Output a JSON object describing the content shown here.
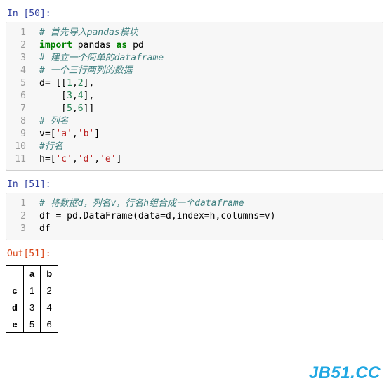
{
  "cells": [
    {
      "prompt": "In [50]:",
      "lines": [
        {
          "n": "1",
          "tokens": [
            {
              "t": "# 首先导入pandas模块",
              "c": "tok-comment"
            }
          ]
        },
        {
          "n": "2",
          "tokens": [
            {
              "t": "import",
              "c": "tok-keyword"
            },
            {
              "t": " pandas "
            },
            {
              "t": "as",
              "c": "tok-keyword"
            },
            {
              "t": " pd"
            }
          ]
        },
        {
          "n": "3",
          "tokens": [
            {
              "t": "# 建立一个简单的dataframe",
              "c": "tok-comment"
            }
          ]
        },
        {
          "n": "4",
          "tokens": [
            {
              "t": "# 一个三行两列的数据",
              "c": "tok-comment"
            }
          ]
        },
        {
          "n": "5",
          "tokens": [
            {
              "t": "d= [["
            },
            {
              "t": "1",
              "c": "tok-number"
            },
            {
              "t": ","
            },
            {
              "t": "2",
              "c": "tok-number"
            },
            {
              "t": "],"
            }
          ]
        },
        {
          "n": "6",
          "tokens": [
            {
              "t": "    ["
            },
            {
              "t": "3",
              "c": "tok-number"
            },
            {
              "t": ","
            },
            {
              "t": "4",
              "c": "tok-number"
            },
            {
              "t": "],"
            }
          ]
        },
        {
          "n": "7",
          "tokens": [
            {
              "t": "    ["
            },
            {
              "t": "5",
              "c": "tok-number"
            },
            {
              "t": ","
            },
            {
              "t": "6",
              "c": "tok-number"
            },
            {
              "t": "]]"
            }
          ]
        },
        {
          "n": "8",
          "tokens": [
            {
              "t": "# 列名",
              "c": "tok-comment"
            }
          ]
        },
        {
          "n": "9",
          "tokens": [
            {
              "t": "v=["
            },
            {
              "t": "'a'",
              "c": "tok-string"
            },
            {
              "t": ","
            },
            {
              "t": "'b'",
              "c": "tok-string"
            },
            {
              "t": "]"
            }
          ]
        },
        {
          "n": "10",
          "tokens": [
            {
              "t": "#行名",
              "c": "tok-comment"
            }
          ]
        },
        {
          "n": "11",
          "tokens": [
            {
              "t": "h=["
            },
            {
              "t": "'c'",
              "c": "tok-string"
            },
            {
              "t": ","
            },
            {
              "t": "'d'",
              "c": "tok-string"
            },
            {
              "t": ","
            },
            {
              "t": "'e'",
              "c": "tok-string"
            },
            {
              "t": "]"
            }
          ]
        }
      ]
    },
    {
      "prompt": "In [51]:",
      "lines": [
        {
          "n": "1",
          "tokens": [
            {
              "t": "# 将数据d，列名v，行名h组合成一个dataframe",
              "c": "tok-comment"
            }
          ]
        },
        {
          "n": "2",
          "tokens": [
            {
              "t": "df = pd.DataFrame(data=d,index=h,columns=v)"
            }
          ]
        },
        {
          "n": "3",
          "tokens": [
            {
              "t": "df"
            }
          ]
        }
      ]
    }
  ],
  "output": {
    "prompt": "Out[51]:",
    "columns": [
      "a",
      "b"
    ],
    "index": [
      "c",
      "d",
      "e"
    ],
    "data": [
      [
        "1",
        "2"
      ],
      [
        "3",
        "4"
      ],
      [
        "5",
        "6"
      ]
    ]
  },
  "watermark": "JB51.CC"
}
